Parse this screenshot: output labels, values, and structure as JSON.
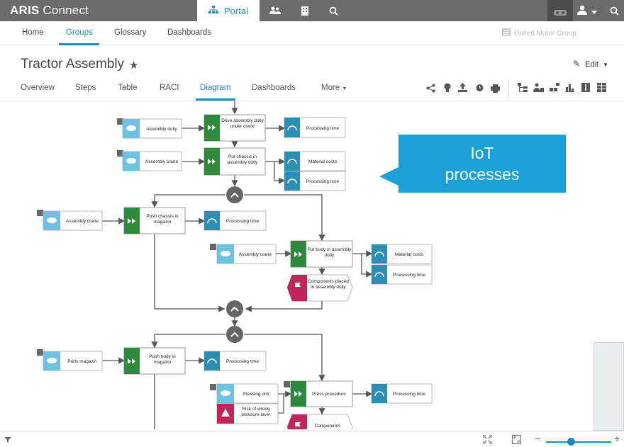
{
  "app": {
    "brand_bold": "ARIS",
    "brand_light": "Connect"
  },
  "topbar": {
    "portal_label": "Portal",
    "icons": [
      "sitemap-icon",
      "users-icon",
      "building-icon",
      "search-icon",
      "vr-icon",
      "user-icon",
      "chevron-down-icon",
      "search-icon"
    ]
  },
  "subnav": {
    "items": [
      "Home",
      "Groups",
      "Glossary",
      "Dashboards"
    ],
    "active": "Groups",
    "company": "United Motor Group"
  },
  "page": {
    "title": "Tractor Assembly",
    "edit_label": "Edit"
  },
  "tabs": {
    "items": [
      "Overview",
      "Steps",
      "Table",
      "RACI",
      "Diagram",
      "Dashboards",
      "More"
    ],
    "active": "Diagram"
  },
  "callout": {
    "line1": "IoT",
    "line2": "processes"
  },
  "diagram": {
    "objects": {
      "o1": "Assembly dolly",
      "o2": "Assembly crane",
      "o3": "Assembly crane",
      "o4": "Assembly crane",
      "o5": "Parts magazin",
      "o6": "Pressing unit",
      "risk1": "Risk of wrong pressure lever"
    },
    "functions": {
      "f1": "Drive assembly dolly under crane",
      "f2": "Put chassis in assembly dolly",
      "f3": "Push chassis in magazin",
      "f4": "Put body in assembly dolly",
      "f5": "Push body in magazin",
      "f6": "Press procedure"
    },
    "kpis": {
      "k1": "Processing time",
      "k2": "Material costs",
      "k3": "Processing time",
      "k4": "Processing time",
      "k5": "Material costs",
      "k6": "Processing time",
      "k7": "Processing time",
      "k8": "Processing time"
    },
    "events": {
      "e1": "Components placed in assembly dolly",
      "e2": "Components"
    }
  },
  "colors": {
    "accent": "#1a8bc0",
    "function_green": "#2e8b3e",
    "kpi_blue": "#2a8fb3",
    "object_lightblue": "#6cc2e0",
    "risk_red": "#c0245a",
    "callout": "#1a9fd6"
  }
}
